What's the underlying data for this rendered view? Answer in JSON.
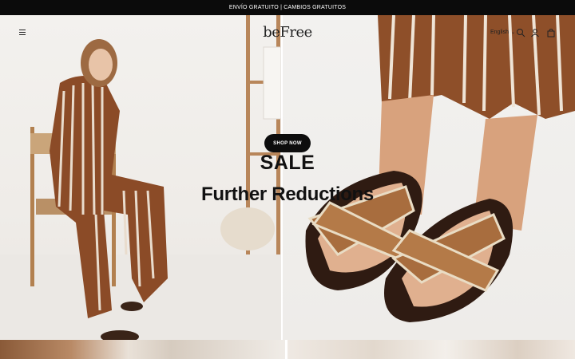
{
  "announcement": "ENVÍO GRATUITO | CAMBIOS GRATUITOS",
  "header": {
    "logo": "beFree",
    "language": "English"
  },
  "hero": {
    "cta_label": "SHOP NOW",
    "title": "SALE",
    "subtitle": "Further Reductions"
  }
}
